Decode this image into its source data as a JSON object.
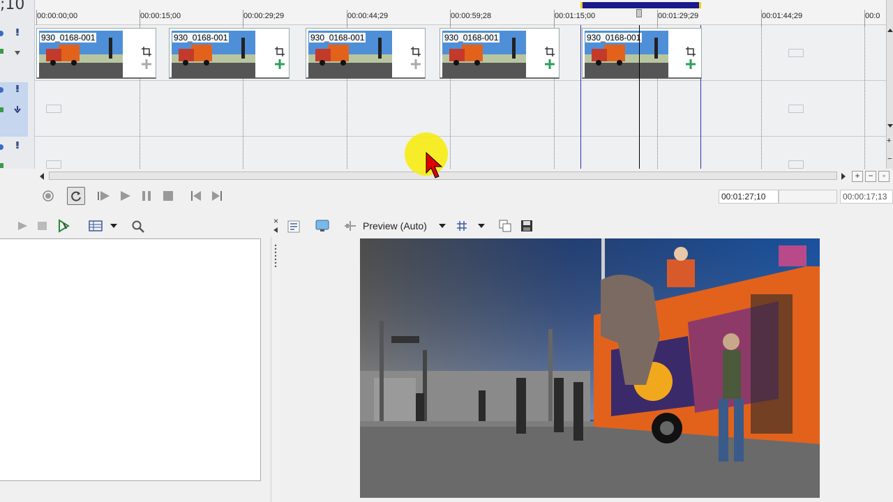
{
  "timeline": {
    "time_readout": ";10",
    "ruler_ticks": [
      "00:00:00;00",
      "00:00:15;00",
      "00:00:29;29",
      "00:00:44;29",
      "00:00:59;28",
      "00:01:15;00",
      "00:01:29;29",
      "00:01:44;29",
      "00:0"
    ],
    "events": [
      {
        "name": "930_0168-001"
      },
      {
        "name": "930_0168-001"
      },
      {
        "name": "930_0168-001"
      },
      {
        "name": "930_0168-001"
      },
      {
        "name": "930_0168-001"
      }
    ]
  },
  "transport": {
    "cursor_time": "00:01:27;10",
    "selection_length": "00:00:17;13"
  },
  "preview": {
    "mode_label": "Preview (Auto)"
  },
  "colors": {
    "loop_region": "#1a1a8a",
    "loop_handles": "#f3d312",
    "mouse_highlight": "#f6ec1c",
    "cursor_arrow": "#e10000"
  }
}
